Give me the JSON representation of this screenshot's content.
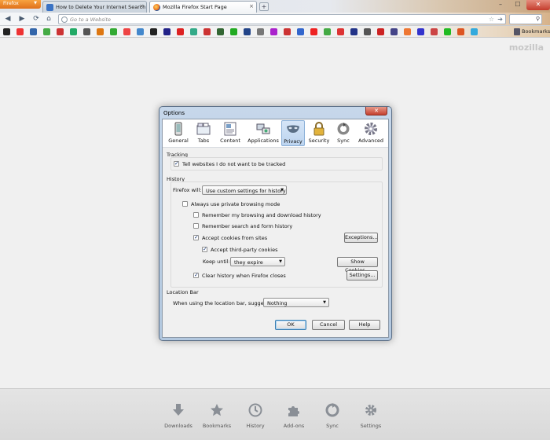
{
  "browser": {
    "app_button": "Firefox",
    "tabs": [
      {
        "title": "How to Delete Your Internet Search H..."
      },
      {
        "title": "Mozilla Firefox Start Page"
      }
    ],
    "url_placeholder": "Go to a Website",
    "bookmarks_label": "Bookmarks",
    "window_controls": {
      "minimize": "–",
      "maximize": "☐",
      "close": "✕"
    }
  },
  "page": {
    "logo": "mozilla"
  },
  "launcher": [
    {
      "label": "Downloads",
      "icon": "download-icon"
    },
    {
      "label": "Bookmarks",
      "icon": "star-icon"
    },
    {
      "label": "History",
      "icon": "clock-icon"
    },
    {
      "label": "Add-ons",
      "icon": "puzzle-icon"
    },
    {
      "label": "Sync",
      "icon": "sync-icon"
    },
    {
      "label": "Settings",
      "icon": "gear-icon"
    }
  ],
  "dialog": {
    "title": "Options",
    "close": "✕",
    "panes": [
      {
        "label": "General",
        "icon": "phone-icon"
      },
      {
        "label": "Tabs",
        "icon": "tabs-icon"
      },
      {
        "label": "Content",
        "icon": "content-icon"
      },
      {
        "label": "Applications",
        "icon": "applications-icon"
      },
      {
        "label": "Privacy",
        "icon": "mask-icon",
        "active": true
      },
      {
        "label": "Security",
        "icon": "lock-icon"
      },
      {
        "label": "Sync",
        "icon": "sync-icon"
      },
      {
        "label": "Advanced",
        "icon": "gear-icon"
      }
    ],
    "tracking": {
      "heading": "Tracking",
      "do_not_track": {
        "label": "Tell websites I do not want to be tracked",
        "checked": true
      }
    },
    "history": {
      "heading": "History",
      "firefox_will_label": "Firefox will:",
      "firefox_will_value": "Use custom settings for history",
      "private_mode": {
        "label": "Always use private browsing mode",
        "checked": false
      },
      "remember_browsing": {
        "label": "Remember my browsing and download history",
        "checked": false
      },
      "remember_search": {
        "label": "Remember search and form history",
        "checked": false
      },
      "accept_cookies": {
        "label": "Accept cookies from sites",
        "checked": true
      },
      "exceptions_button": "Exceptions...",
      "accept_third_party": {
        "label": "Accept third-party cookies",
        "checked": true
      },
      "keep_until_label": "Keep until:",
      "keep_until_value": "they expire",
      "show_cookies_button": "Show Cookies...",
      "clear_on_close": {
        "label": "Clear history when Firefox closes",
        "checked": true
      },
      "settings_button": "Settings..."
    },
    "location_bar": {
      "heading": "Location Bar",
      "suggest_label": "When using the location bar, suggest:",
      "suggest_value": "Nothing"
    },
    "buttons": {
      "ok": "OK",
      "cancel": "Cancel",
      "help": "Help"
    }
  }
}
